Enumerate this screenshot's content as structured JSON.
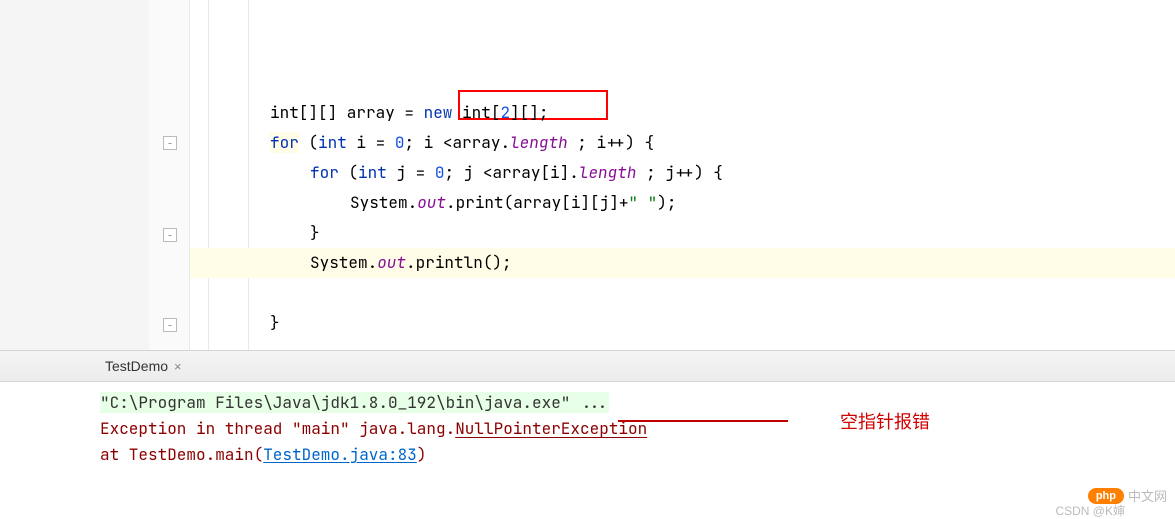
{
  "code": {
    "line1_pre": "int[][] array = ",
    "line1_kw_new": "new",
    "line1_mid": " int[",
    "line1_num": "2",
    "line1_post": "][];",
    "line2_for": "for",
    "line2_pre": " (",
    "line2_int": "int",
    "line2_var": " i = ",
    "line2_zero": "0",
    "line2_mid": "; i <array.",
    "line2_len": "length",
    "line2_post": " ; i++) {",
    "line3_for": "for",
    "line3_pre": " (",
    "line3_int": "int",
    "line3_var": " j = ",
    "line3_zero": "0",
    "line3_mid": "; j <array[i].",
    "line3_len": "length",
    "line3_post": " ; j++) {",
    "line4_pre": "System.",
    "line4_out": "out",
    "line4_mid": ".print(array[i][j]+",
    "line4_str": "\" \"",
    "line4_post": ");",
    "line5": "}",
    "line6_pre": "System.",
    "line6_out": "out",
    "line6_post": ".println();",
    "line8": "}"
  },
  "tab": {
    "label": "TestDemo",
    "close": "×"
  },
  "console": {
    "cmd": "\"C:\\Program Files\\Java\\jdk1.8.0_192\\bin\\java.exe\" ...",
    "exc_pre": "Exception in thread \"main\" java.lang.",
    "exc_name": "NullPointerException",
    "at_pre": "    at TestDemo.main(",
    "at_link": "TestDemo.java:83",
    "at_post": ")"
  },
  "annotation": "空指针报错",
  "watermark": {
    "badge": "php",
    "text1": "中文网",
    "text2": "CSDN @K婶"
  }
}
